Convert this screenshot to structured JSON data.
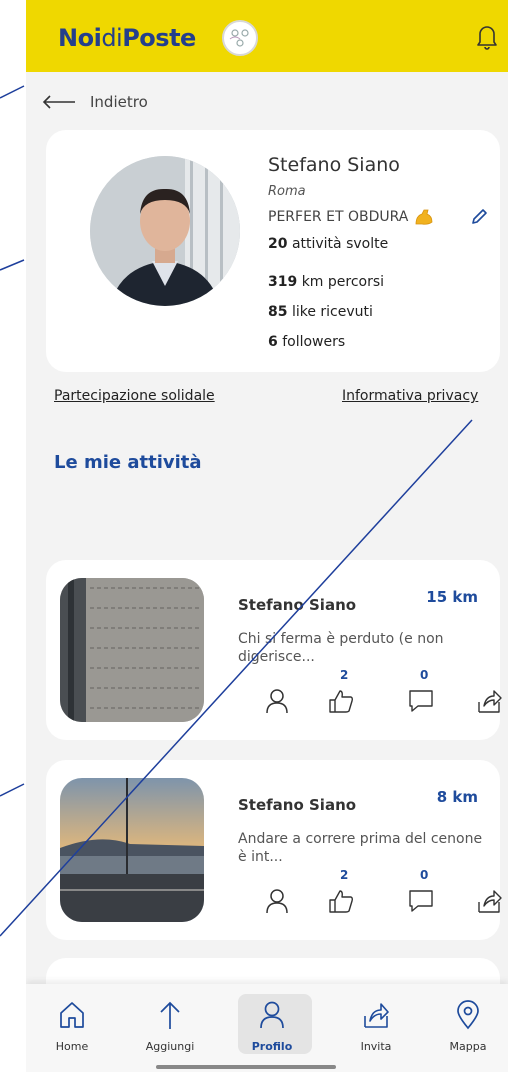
{
  "header": {
    "logo_bold_1": "Noi",
    "logo_thin": "di",
    "logo_bold_2": "Poste"
  },
  "back": {
    "label": "Indietro"
  },
  "profile": {
    "name": "Stefano Siano",
    "city": "Roma",
    "motto": "PERFER ET OBDURA",
    "stats": [
      {
        "value": "20",
        "label": "attività svolte"
      },
      {
        "value": "319",
        "label": "km percorsi"
      },
      {
        "value": "85",
        "label": "like ricevuti"
      },
      {
        "value": "6",
        "label": "followers"
      }
    ]
  },
  "links": {
    "left": "Partecipazione solidale",
    "right": "Informativa privacy"
  },
  "section": {
    "title": "Le mie attività"
  },
  "activities": [
    {
      "author": "Stefano Siano",
      "distance": "15 km",
      "description": "Chi si ferma è perduto (e non digerisce...",
      "likes": "2",
      "comments": "0"
    },
    {
      "author": "Stefano Siano",
      "distance": "8 km",
      "description": "Andare a correre prima del cenone è int...",
      "likes": "2",
      "comments": "0"
    }
  ],
  "nav": [
    {
      "label": "Home",
      "icon": "home-icon"
    },
    {
      "label": "Aggiungi",
      "icon": "arrow-up-icon"
    },
    {
      "label": "Profilo",
      "icon": "user-icon"
    },
    {
      "label": "Invita",
      "icon": "share-icon"
    },
    {
      "label": "Mappa",
      "icon": "map-pin-icon"
    }
  ],
  "colors": {
    "header": "#efd800",
    "accent": "#1e4b9c",
    "background": "#f3f3f3"
  }
}
